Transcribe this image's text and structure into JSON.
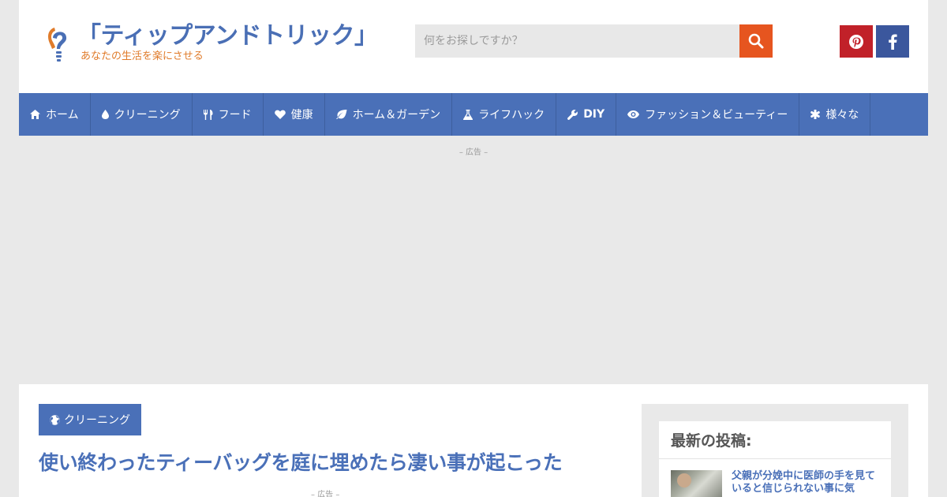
{
  "header": {
    "logo_title": "「ティップアンドトリック」",
    "logo_tagline": "あなたの生活を楽にさせる",
    "search_placeholder": "何をお探しですか？",
    "colors": {
      "brand": "#4a6fb5",
      "accent": "#e07b2a",
      "search_button": "#e6551f"
    }
  },
  "social": [
    {
      "name": "pinterest",
      "icon": "pinterest-icon",
      "color": "#c12129"
    },
    {
      "name": "facebook",
      "icon": "facebook-icon",
      "color": "#3b579d"
    }
  ],
  "nav": {
    "color": "#4a70b8",
    "items": [
      {
        "label": "ホーム",
        "icon": "home-icon"
      },
      {
        "label": "クリーニング",
        "icon": "drop-icon"
      },
      {
        "label": "フード",
        "icon": "cutlery-icon"
      },
      {
        "label": "健康",
        "icon": "heart-icon"
      },
      {
        "label": "ホーム＆ガーデン",
        "icon": "leaf-icon"
      },
      {
        "label": "ライフハック",
        "icon": "flask-icon"
      },
      {
        "label": "DIY",
        "icon": "wrench-icon"
      },
      {
        "label": "ファッション＆ビューティー",
        "icon": "eye-icon"
      },
      {
        "label": "様々な",
        "icon": "asterisk-icon"
      }
    ]
  },
  "ad_label": "– 広告 –",
  "article": {
    "category": "クリーニング",
    "category_icon": "globe-icon",
    "title": "使い終わったティーバッグを庭に埋めたら凄い事が起こった",
    "ad_label": "– 広告 –"
  },
  "sidebar": {
    "widget_title": "最新の投稿:",
    "recent_posts": [
      {
        "title": "父親が分娩中に医師の手を見ていると信じられない事に気"
      }
    ]
  }
}
